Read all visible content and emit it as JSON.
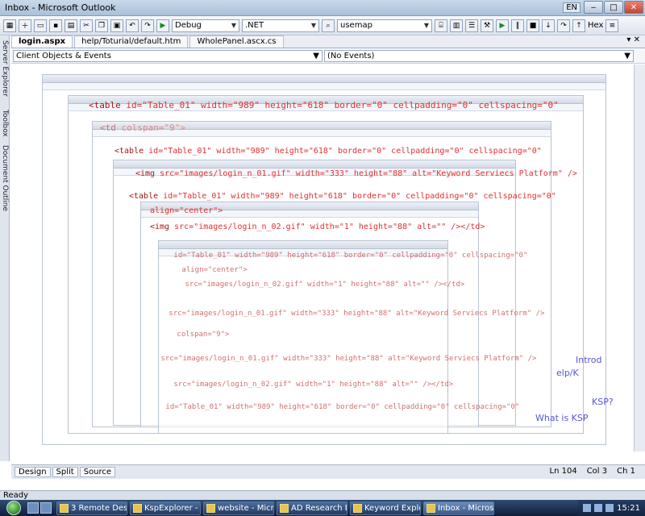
{
  "window": {
    "title": "Inbox - Microsoft Outlook",
    "lang": "EN"
  },
  "toolbar": {
    "config": "Debug",
    "platform": ".NET",
    "find": "usemap",
    "hex": "Hex"
  },
  "sidebar": {
    "server_explorer": "Server Explorer",
    "toolbox": "Toolbox",
    "doc_outline": "Document Outline"
  },
  "editor": {
    "tabs": [
      "login.aspx",
      "help/Toturial/default.htm",
      "WholePanel.ascx.cs"
    ],
    "nav_left": "Client Objects & Events",
    "nav_right": "(No Events)",
    "lines": [
      {
        "tag": "<table",
        "attrs": " id=\"Table_01\" width=\"989\" height=\"618\" border=\"0\" cellpadding=\"0\" cellspacing=\"0\""
      },
      {
        "tag": "<td",
        "attrs": " colspan=\"9\">"
      },
      {
        "tag": "<img",
        "attrs": " src=\"images/login_n_01.gif\" width=\"333\" height=\"88\" alt=\"Keyword Serviecs Platform\" />"
      },
      {
        "tag": "<td",
        "attrs": " align=\"center\">"
      },
      {
        "tag": "<img",
        "attrs": " src=\"images/login_n_02.gif\" width=\"1\" height=\"88\" alt=\"\" /></td>"
      }
    ],
    "links": [
      "Introd",
      "elp/K",
      "KSP?",
      "What is KSP"
    ]
  },
  "bottom": {
    "tabs": [
      "Design",
      "Split",
      "Source"
    ],
    "ln": "Ln 104",
    "col": "Col 3",
    "ch": "Ch 1"
  },
  "status": {
    "text": "Ready"
  },
  "taskbar": {
    "items": [
      "3 Remote Des...",
      "KspExplorer - M...",
      "website - Micro...",
      "AD Research Da...",
      "Keyword Explor...",
      "Inbox - Microso..."
    ],
    "clock": "15:21"
  },
  "colors": {
    "taskbar": "#1b2e4d",
    "tag": "#a31515",
    "attr": "#e03030"
  }
}
